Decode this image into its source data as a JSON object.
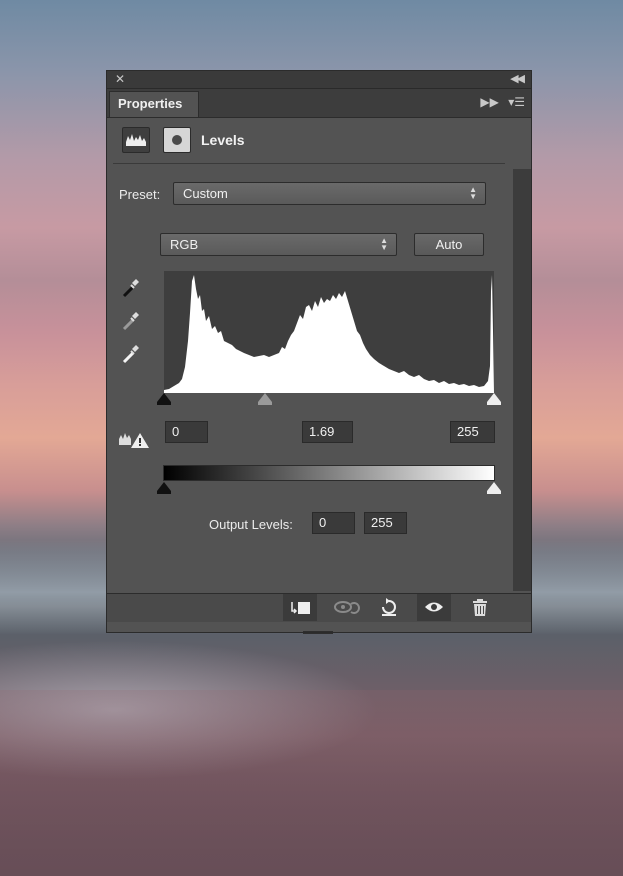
{
  "panel": {
    "tab_label": "Properties",
    "adjustment_title": "Levels",
    "preset_label": "Preset:",
    "preset_value": "Custom",
    "channel_value": "RGB",
    "auto_label": "Auto",
    "input_black": "0",
    "input_gamma": "1.69",
    "input_white": "255",
    "output_label": "Output Levels:",
    "output_black": "0",
    "output_white": "255"
  },
  "icons": {
    "close": "close-icon",
    "collapse": "collapse-icon",
    "panel_menu": "panel-menu-icon",
    "levels": "levels-histogram-icon",
    "mask": "mask-icon",
    "black_eyedropper": "black-point-eyedropper-icon",
    "gray_eyedropper": "gray-point-eyedropper-icon",
    "white_eyedropper": "white-point-eyedropper-icon",
    "calculate_warning": "calculate-histogram-warning-icon",
    "clip": "clip-to-layer-icon",
    "view_previous": "view-previous-state-icon",
    "reset": "reset-icon",
    "visibility": "visibility-eye-icon",
    "delete": "trash-icon"
  },
  "colors": {
    "panel_bg": "#535353",
    "field_bg": "#3a3a3a",
    "histogram_bg": "#3e3e3e"
  }
}
